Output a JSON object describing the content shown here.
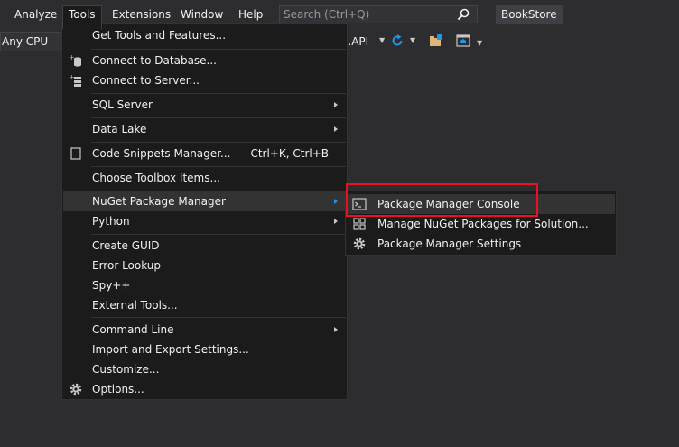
{
  "menubar": {
    "items": [
      "Analyze",
      "Tools",
      "Extensions",
      "Window",
      "Help"
    ],
    "search_placeholder": "Search (Ctrl+Q)",
    "app_title": "BookStore"
  },
  "toolbar": {
    "platform": "Any CPU",
    "project": "e.API"
  },
  "tools_menu": {
    "items": [
      {
        "label": "Get Tools and Features...",
        "icon": "none"
      },
      {
        "label": "Connect to Database...",
        "icon": "database-connect-icon"
      },
      {
        "label": "Connect to Server...",
        "icon": "server-connect-icon"
      },
      {
        "label": "SQL Server",
        "submenu": true
      },
      {
        "label": "Data Lake",
        "submenu": true
      },
      {
        "label": "Code Snippets Manager...",
        "shortcut": "Ctrl+K, Ctrl+B",
        "icon": "snippet-icon"
      },
      {
        "label": "Choose Toolbox Items..."
      },
      {
        "label": "NuGet Package Manager",
        "submenu": true,
        "highlighted": true
      },
      {
        "label": "Python",
        "submenu": true
      },
      {
        "label": "Create GUID"
      },
      {
        "label": "Error Lookup"
      },
      {
        "label": "Spy++"
      },
      {
        "label": "External Tools..."
      },
      {
        "label": "Command Line",
        "submenu": true
      },
      {
        "label": "Import and Export Settings..."
      },
      {
        "label": "Customize..."
      },
      {
        "label": "Options...",
        "icon": "gear-icon"
      }
    ]
  },
  "nuget_submenu": {
    "items": [
      {
        "label": "Package Manager Console",
        "icon": "console-icon",
        "highlighted": true
      },
      {
        "label": "Manage NuGet Packages for Solution...",
        "icon": "packages-icon"
      },
      {
        "label": "Package Manager Settings",
        "icon": "gear-icon"
      }
    ]
  },
  "colors": {
    "background": "#2d2d30",
    "menu_background": "#1b1b1c",
    "highlight": "#333334",
    "accent": "#1c97ea",
    "annotation": "#e81123"
  }
}
